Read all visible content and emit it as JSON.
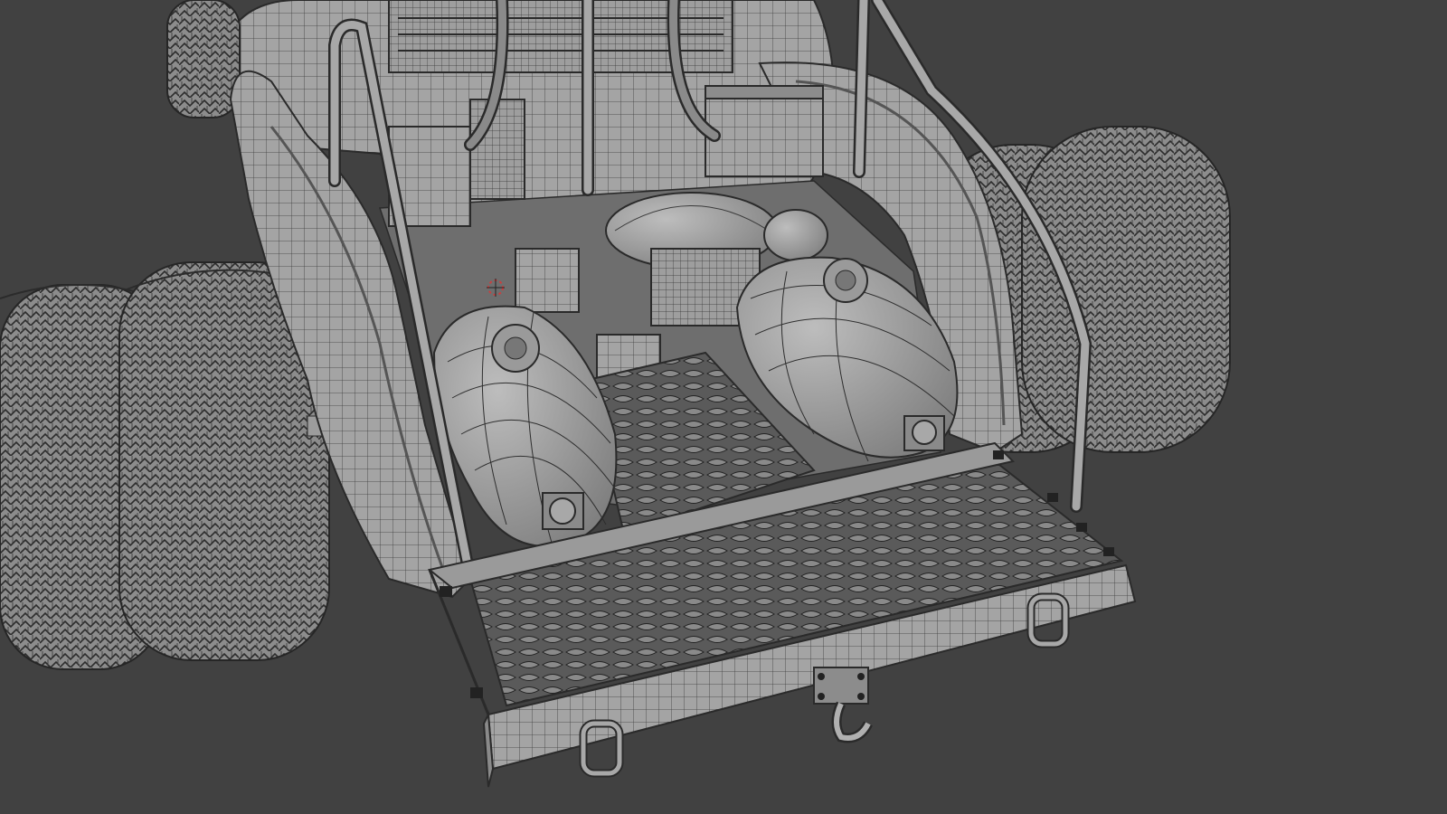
{
  "viewport": {
    "mode": "wireframe-overlay",
    "background_color": "#414141",
    "mesh_color": "#9a9a9a",
    "wire_color": "#2a2a2a",
    "cursor": "3d-cursor-icon"
  },
  "scene": {
    "objects": [
      "rear-left-tire-outer",
      "rear-left-tire-inner",
      "rear-right-tire-outer",
      "rear-right-tire-inner",
      "cab-body",
      "roll-cage",
      "left-fender",
      "right-fender",
      "left-air-tank",
      "right-air-tank",
      "rear-air-tank",
      "battery-box",
      "toolbox",
      "diamond-plate-floor",
      "rear-deck-plate",
      "rear-bumper",
      "tow-hook",
      "bumper-handle-left",
      "bumper-handle-right",
      "tailgate-handle",
      "spare-wheels"
    ]
  }
}
